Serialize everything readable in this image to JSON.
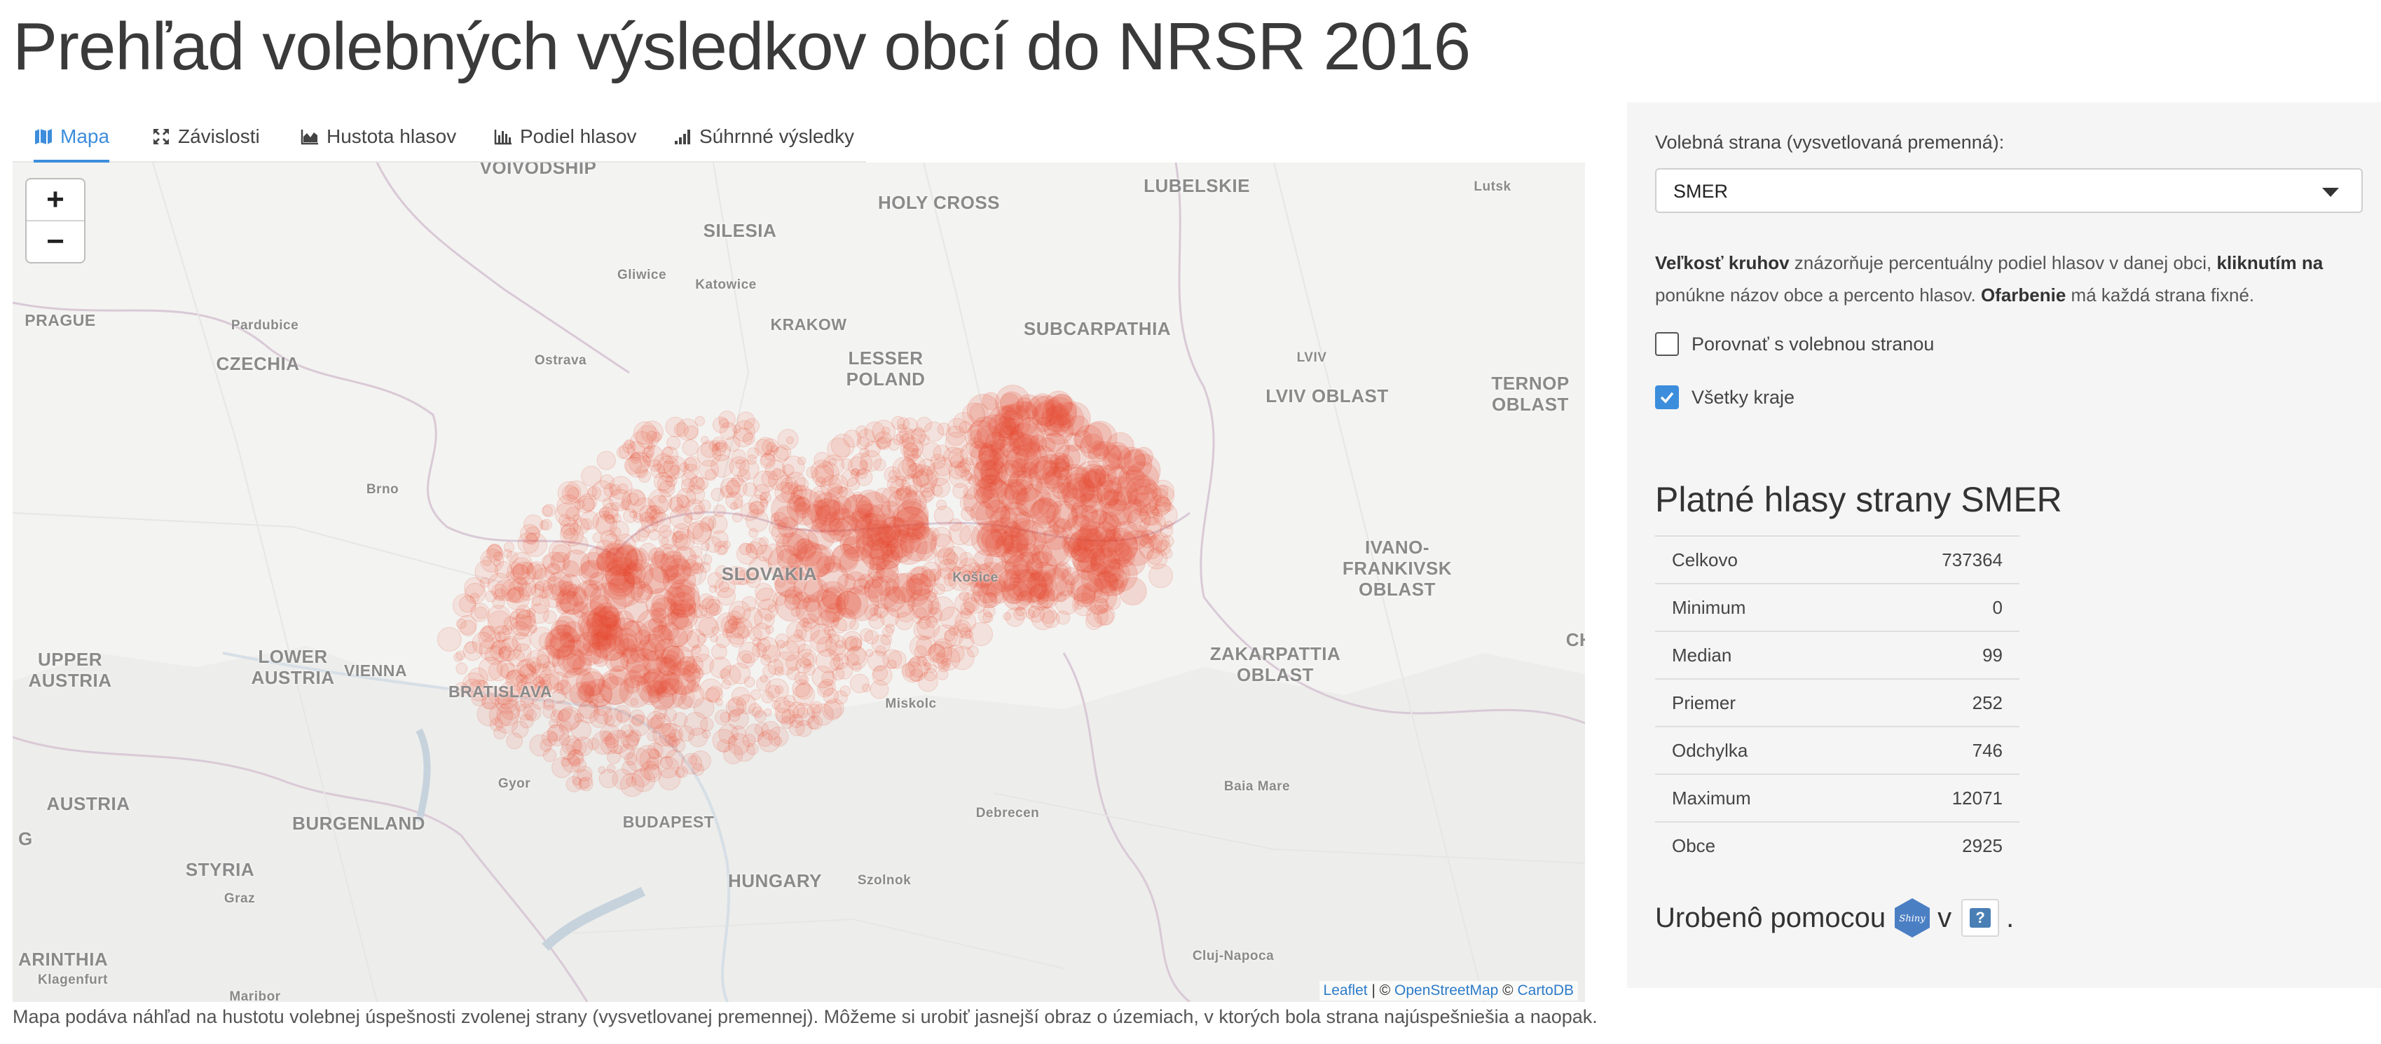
{
  "page": {
    "title": "Prehľad volebných výsledkov obcí do NRSR 2016"
  },
  "tabs": [
    {
      "label": "Mapa",
      "icon": "map-icon",
      "active": true
    },
    {
      "label": "Závislosti",
      "icon": "expand-icon",
      "active": false
    },
    {
      "label": "Hustota hlasov",
      "icon": "area-chart-icon",
      "active": false
    },
    {
      "label": "Podiel hlasov",
      "icon": "bar-chart-icon",
      "active": false
    },
    {
      "label": "Súhrnné výsledky",
      "icon": "signal-icon",
      "active": false
    }
  ],
  "map": {
    "zoom_in": "+",
    "zoom_out": "−",
    "point_color": "#e9462a",
    "labels": [
      {
        "text": "VOIVODSHIP"
      },
      {
        "text": "LUBELSKIE"
      },
      {
        "text": "HOLY CROSS"
      },
      {
        "text": "Lutsk"
      },
      {
        "text": "SILESIA"
      },
      {
        "text": "Gliwice"
      },
      {
        "text": "Katowice"
      },
      {
        "text": "PRAGUE"
      },
      {
        "text": "Pardubice"
      },
      {
        "text": "KRAKOW"
      },
      {
        "text": "SUBCARPATHIA"
      },
      {
        "text": "CZECHIA"
      },
      {
        "text": "Ostrava"
      },
      {
        "text": "LESSER"
      },
      {
        "text": "POLAND"
      },
      {
        "text": "LVIV"
      },
      {
        "text": "LVIV OBLAST"
      },
      {
        "text": "TERNOP"
      },
      {
        "text": "OBLAST"
      },
      {
        "text": "Brno"
      },
      {
        "text": "SLOVAKIA"
      },
      {
        "text": "Košice"
      },
      {
        "text": "IVANO-"
      },
      {
        "text": "FRANKIVSK"
      },
      {
        "text": "OBLAST"
      },
      {
        "text": "UPPER"
      },
      {
        "text": "AUSTRIA"
      },
      {
        "text": "LOWER"
      },
      {
        "text": "AUSTRIA"
      },
      {
        "text": "VIENNA"
      },
      {
        "text": "BRATISLAVA"
      },
      {
        "text": "ZAKARPATTIA"
      },
      {
        "text": "OBLAST"
      },
      {
        "text": "CH"
      },
      {
        "text": "Miskolc"
      },
      {
        "text": "Gyor"
      },
      {
        "text": "AUSTRIA"
      },
      {
        "text": "BURGENLAND"
      },
      {
        "text": "BUDAPEST"
      },
      {
        "text": "Debrecen"
      },
      {
        "text": "Baia Mare"
      },
      {
        "text": "G"
      },
      {
        "text": "STYRIA"
      },
      {
        "text": "HUNGARY"
      },
      {
        "text": "Szolnok"
      },
      {
        "text": "Graz"
      },
      {
        "text": "ARINTHIA"
      },
      {
        "text": "Klagenfurt"
      },
      {
        "text": "Maribor"
      },
      {
        "text": "Cluj-Napoca"
      }
    ],
    "attribution": {
      "leaflet": "Leaflet",
      "sep1": " | © ",
      "osm": "OpenStreetMap",
      "sep2": " © ",
      "carto": "CartoDB"
    }
  },
  "caption": "Mapa podáva náhľad na hustotu volebnej úspešnosti zvolenej strany (vysvetlovanej premennej). Môžeme si urobiť jasnejší obraz o územiach, v ktorých bola strana najúspešniešia a naopak.",
  "sidebar": {
    "party_label": "Volebná strana (vysvetlovaná premenná):",
    "party_value": "SMER",
    "help": {
      "p1": "Veľkosť kruhov",
      "p2": " znázorňuje percentuálny podiel hlasov v danej obci, ",
      "p3": "kliknutím na",
      "p4": " ponúkne názov obce a percento hlasov. ",
      "p5": "Ofarbenie",
      "p6": " má každá strana fixné."
    },
    "compare_label": "Porovnať s volebnou stranou",
    "compare_checked": false,
    "all_regions_label": "Všetky kraje",
    "all_regions_checked": true,
    "stats_title": "Platné hlasy strany SMER",
    "stats": [
      {
        "label": "Celkovo",
        "value": "737364"
      },
      {
        "label": "Minimum",
        "value": "0"
      },
      {
        "label": "Median",
        "value": "99"
      },
      {
        "label": "Priemer",
        "value": "252"
      },
      {
        "label": "Odchylka",
        "value": "746"
      },
      {
        "label": "Maximum",
        "value": "12071"
      },
      {
        "label": "Obce",
        "value": "2925"
      }
    ],
    "made_with": "Urobenô pomocou",
    "made_v": "v",
    "made_dot": ".",
    "shiny_text": "Shiny",
    "q_icon": "?"
  },
  "colors": {
    "accent": "#3c8ddc",
    "panel": "#f5f5f5"
  }
}
